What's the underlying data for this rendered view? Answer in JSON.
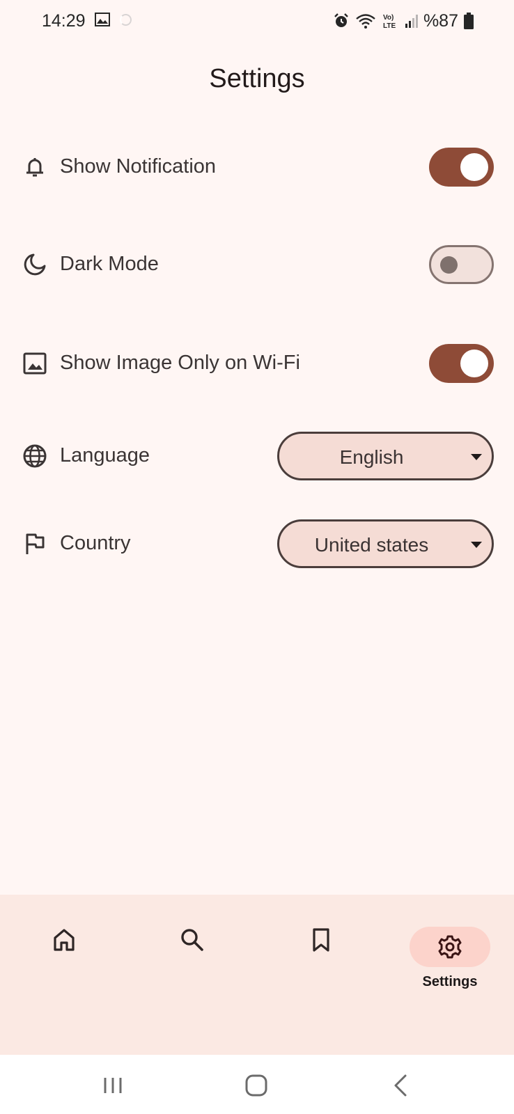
{
  "status_bar": {
    "time": "14:29",
    "battery": "%87",
    "icons": [
      "gallery-icon",
      "loading-icon",
      "alarm-icon",
      "wifi-icon",
      "volte-icon",
      "signal-icon",
      "battery-icon"
    ]
  },
  "page": {
    "title": "Settings"
  },
  "settings": [
    {
      "label": "Show Notification",
      "icon": "bell-icon",
      "type": "switch",
      "on": true
    },
    {
      "label": "Dark Mode",
      "icon": "moon-icon",
      "type": "switch",
      "on": false
    },
    {
      "label": "Show Image Only on Wi-Fi",
      "icon": "image-icon",
      "type": "switch",
      "on": true
    },
    {
      "label": "Language",
      "icon": "globe-icon",
      "type": "dropdown",
      "value": "English"
    },
    {
      "label": "Country",
      "icon": "flag-icon",
      "type": "dropdown",
      "value": "United states"
    }
  ],
  "bottom_nav": {
    "items": [
      {
        "icon": "home-icon",
        "active": false
      },
      {
        "icon": "search-icon",
        "active": false
      },
      {
        "icon": "bookmark-icon",
        "active": false
      },
      {
        "icon": "gear-icon",
        "label": "Settings",
        "active": true
      }
    ]
  },
  "colors": {
    "background": "#fff6f4",
    "accent": "#8e4b37",
    "nav_background": "#fbe9e3",
    "nav_active_pill": "#fcd3cb",
    "dropdown_fill": "#f5dcd5"
  }
}
